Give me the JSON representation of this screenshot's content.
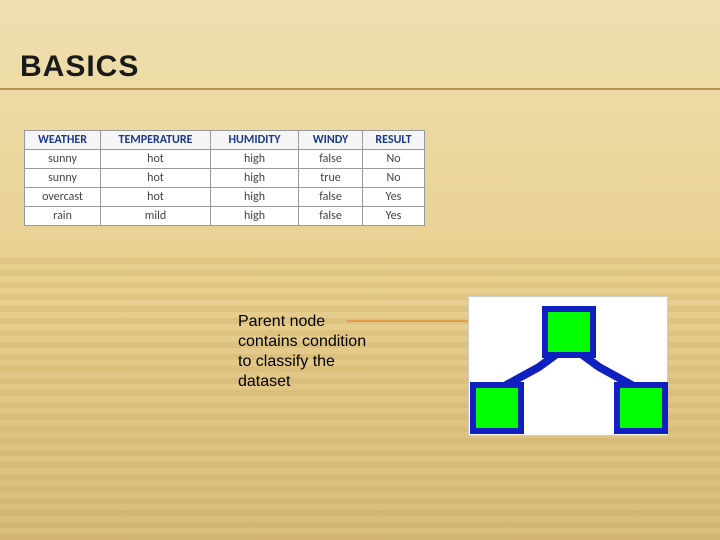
{
  "title": "BASICS",
  "table": {
    "headers": [
      "WEATHER",
      "TEMPERATURE",
      "HUMIDITY",
      "WINDY",
      "RESULT"
    ],
    "rows": [
      [
        "sunny",
        "hot",
        "high",
        "false",
        "No"
      ],
      [
        "sunny",
        "hot",
        "high",
        "true",
        "No"
      ],
      [
        "overcast",
        "hot",
        "high",
        "false",
        "Yes"
      ],
      [
        "rain",
        "mild",
        "high",
        "false",
        "Yes"
      ]
    ]
  },
  "caption": "Parent node contains condition to classify the dataset",
  "tree": {
    "node_color": "#00FF00",
    "edge_color": "#1020C0",
    "border_color": "#1020C0"
  },
  "arrow_color": "#E87B1C"
}
